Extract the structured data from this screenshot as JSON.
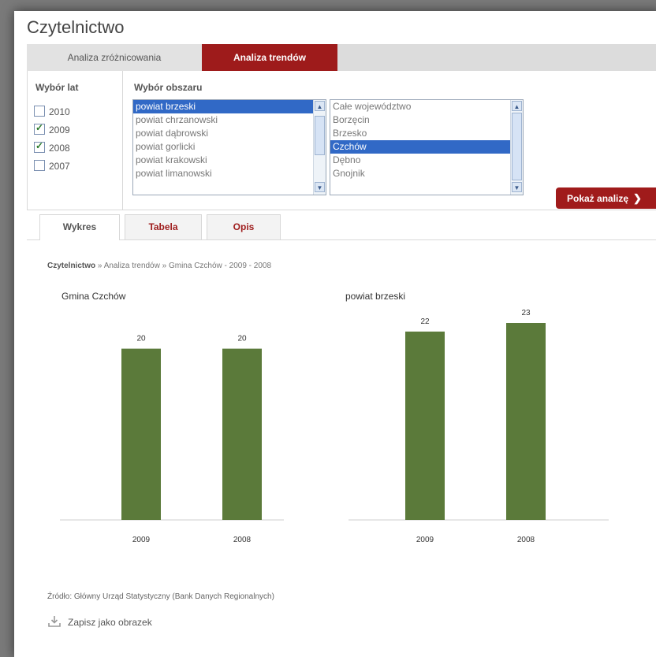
{
  "app_title": "Czytelnictwo",
  "main_tabs": [
    {
      "label": "Analiza zróżnicowania",
      "active": false
    },
    {
      "label": "Analiza trendów",
      "active": true
    }
  ],
  "years": {
    "label": "Wybór lat",
    "items": [
      {
        "label": "2010",
        "checked": false
      },
      {
        "label": "2009",
        "checked": true
      },
      {
        "label": "2008",
        "checked": true
      },
      {
        "label": "2007",
        "checked": false
      }
    ]
  },
  "area": {
    "label": "Wybór obszaru",
    "powiaty": [
      "powiat brzeski",
      "powiat chrzanowski",
      "powiat dąbrowski",
      "powiat gorlicki",
      "powiat krakowski",
      "powiat limanowski"
    ],
    "powiaty_selected": 0,
    "gminy": [
      "Całe województwo",
      "Borzęcin",
      "Brzesko",
      "Czchów",
      "Dębno",
      "Gnojnik"
    ],
    "gminy_selected": 3
  },
  "show_button": "Pokaż analizę",
  "content_tabs": [
    {
      "label": "Wykres",
      "active": true
    },
    {
      "label": "Tabela",
      "active": false
    },
    {
      "label": "Opis",
      "active": false
    }
  ],
  "breadcrumb": {
    "first": "Czytelnictwo",
    "rest": " » Analiza trendów » Gmina Czchów - 2009 - 2008"
  },
  "chart_data": [
    {
      "type": "bar",
      "title": "Gmina Czchów",
      "categories": [
        "2009",
        "2008"
      ],
      "values": [
        20,
        20
      ],
      "color": "#5b7a3a",
      "ylim": [
        0,
        23
      ]
    },
    {
      "type": "bar",
      "title": "powiat brzeski",
      "categories": [
        "2009",
        "2008"
      ],
      "values": [
        22,
        23
      ],
      "color": "#5b7a3a",
      "ylim": [
        0,
        23
      ]
    }
  ],
  "source": "Źródło: Główny Urząd Statystyczny (Bank Danych Regionalnych)",
  "save_label": "Zapisz jako obrazek",
  "colors": {
    "accent": "#9e1b1b",
    "bar": "#5b7a3a",
    "selection": "#3169c6"
  }
}
